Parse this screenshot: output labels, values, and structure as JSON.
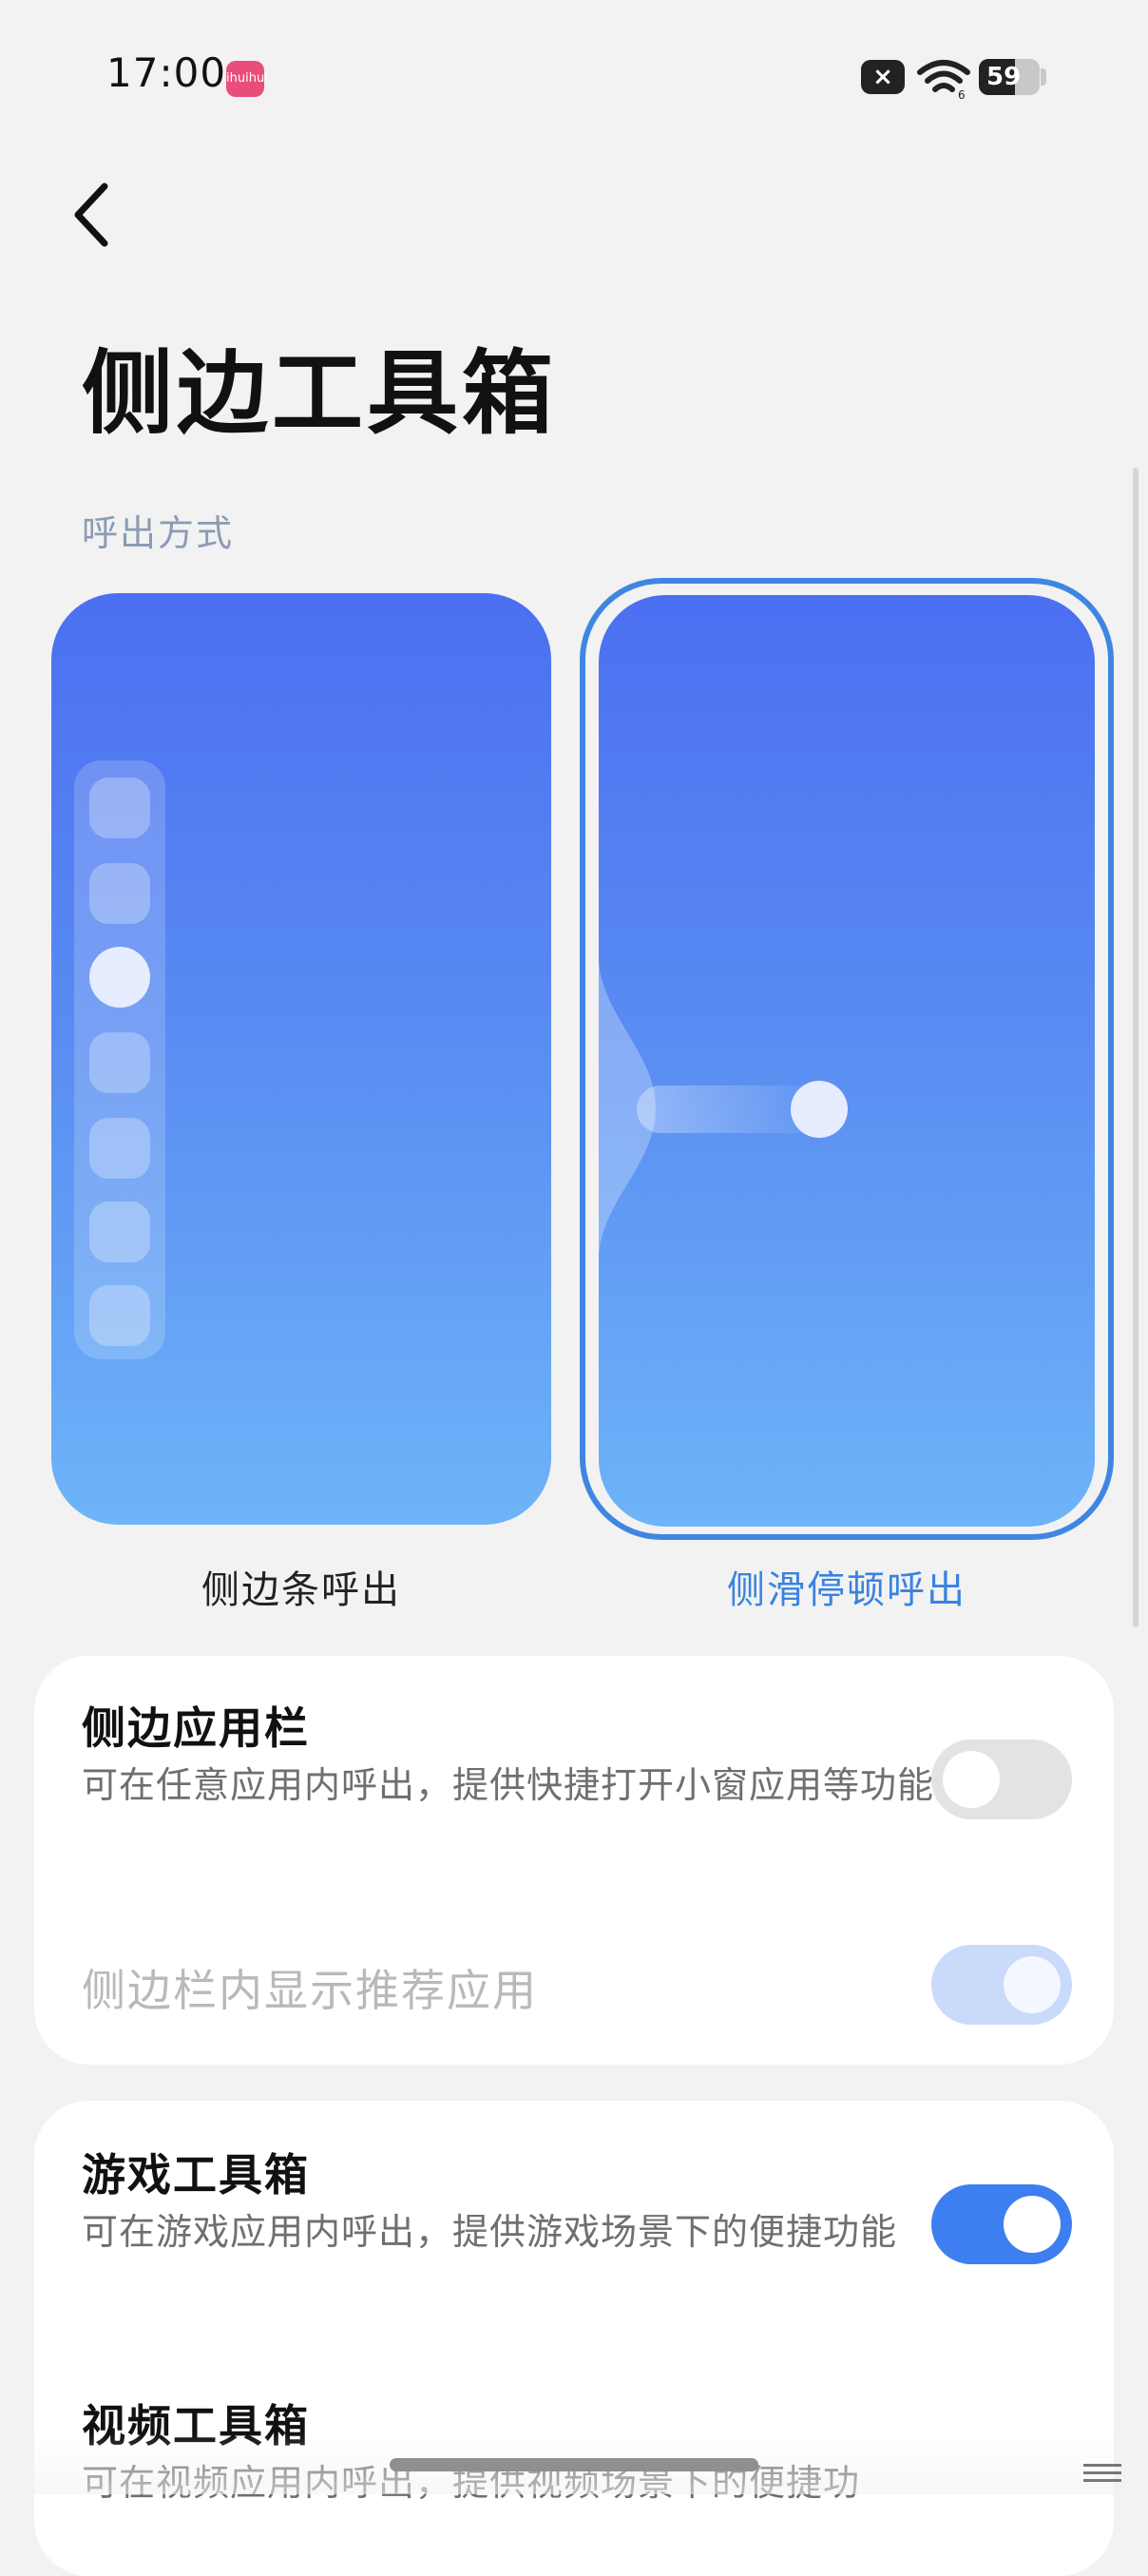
{
  "status_bar": {
    "time": "17:00",
    "app_badge_text": "ihuihui",
    "battery_level": "59",
    "icons": [
      "app-notification-icon",
      "close-badge-icon",
      "wifi-icon",
      "battery-icon"
    ]
  },
  "header": {
    "back_icon": "chevron-left-icon",
    "title": "侧边工具箱"
  },
  "invoke_mode": {
    "section_label": "呼出方式",
    "options": [
      {
        "label": "侧边条呼出",
        "selected": false
      },
      {
        "label": "侧滑停顿呼出",
        "selected": true
      }
    ]
  },
  "groups": [
    {
      "items": [
        {
          "title": "侧边应用栏",
          "description": "可在任意应用内呼出，提供快捷打开小窗应用等功能",
          "toggle": "off"
        },
        {
          "title": "侧边栏内显示推荐应用",
          "toggle": "on-disabled"
        }
      ]
    },
    {
      "items": [
        {
          "title": "游戏工具箱",
          "description": "可在游戏应用内呼出，提供游戏场景下的便捷功能",
          "toggle": "on"
        },
        {
          "title": "视频工具箱",
          "description": "可在视频应用内呼出，提供视频场景下的便捷功"
        }
      ]
    }
  ],
  "colors": {
    "accent": "#3d7ff0",
    "selected_label": "#3a82e0",
    "card_gradient_top": "#4b6ff1",
    "card_gradient_bottom": "#6db4f8"
  }
}
